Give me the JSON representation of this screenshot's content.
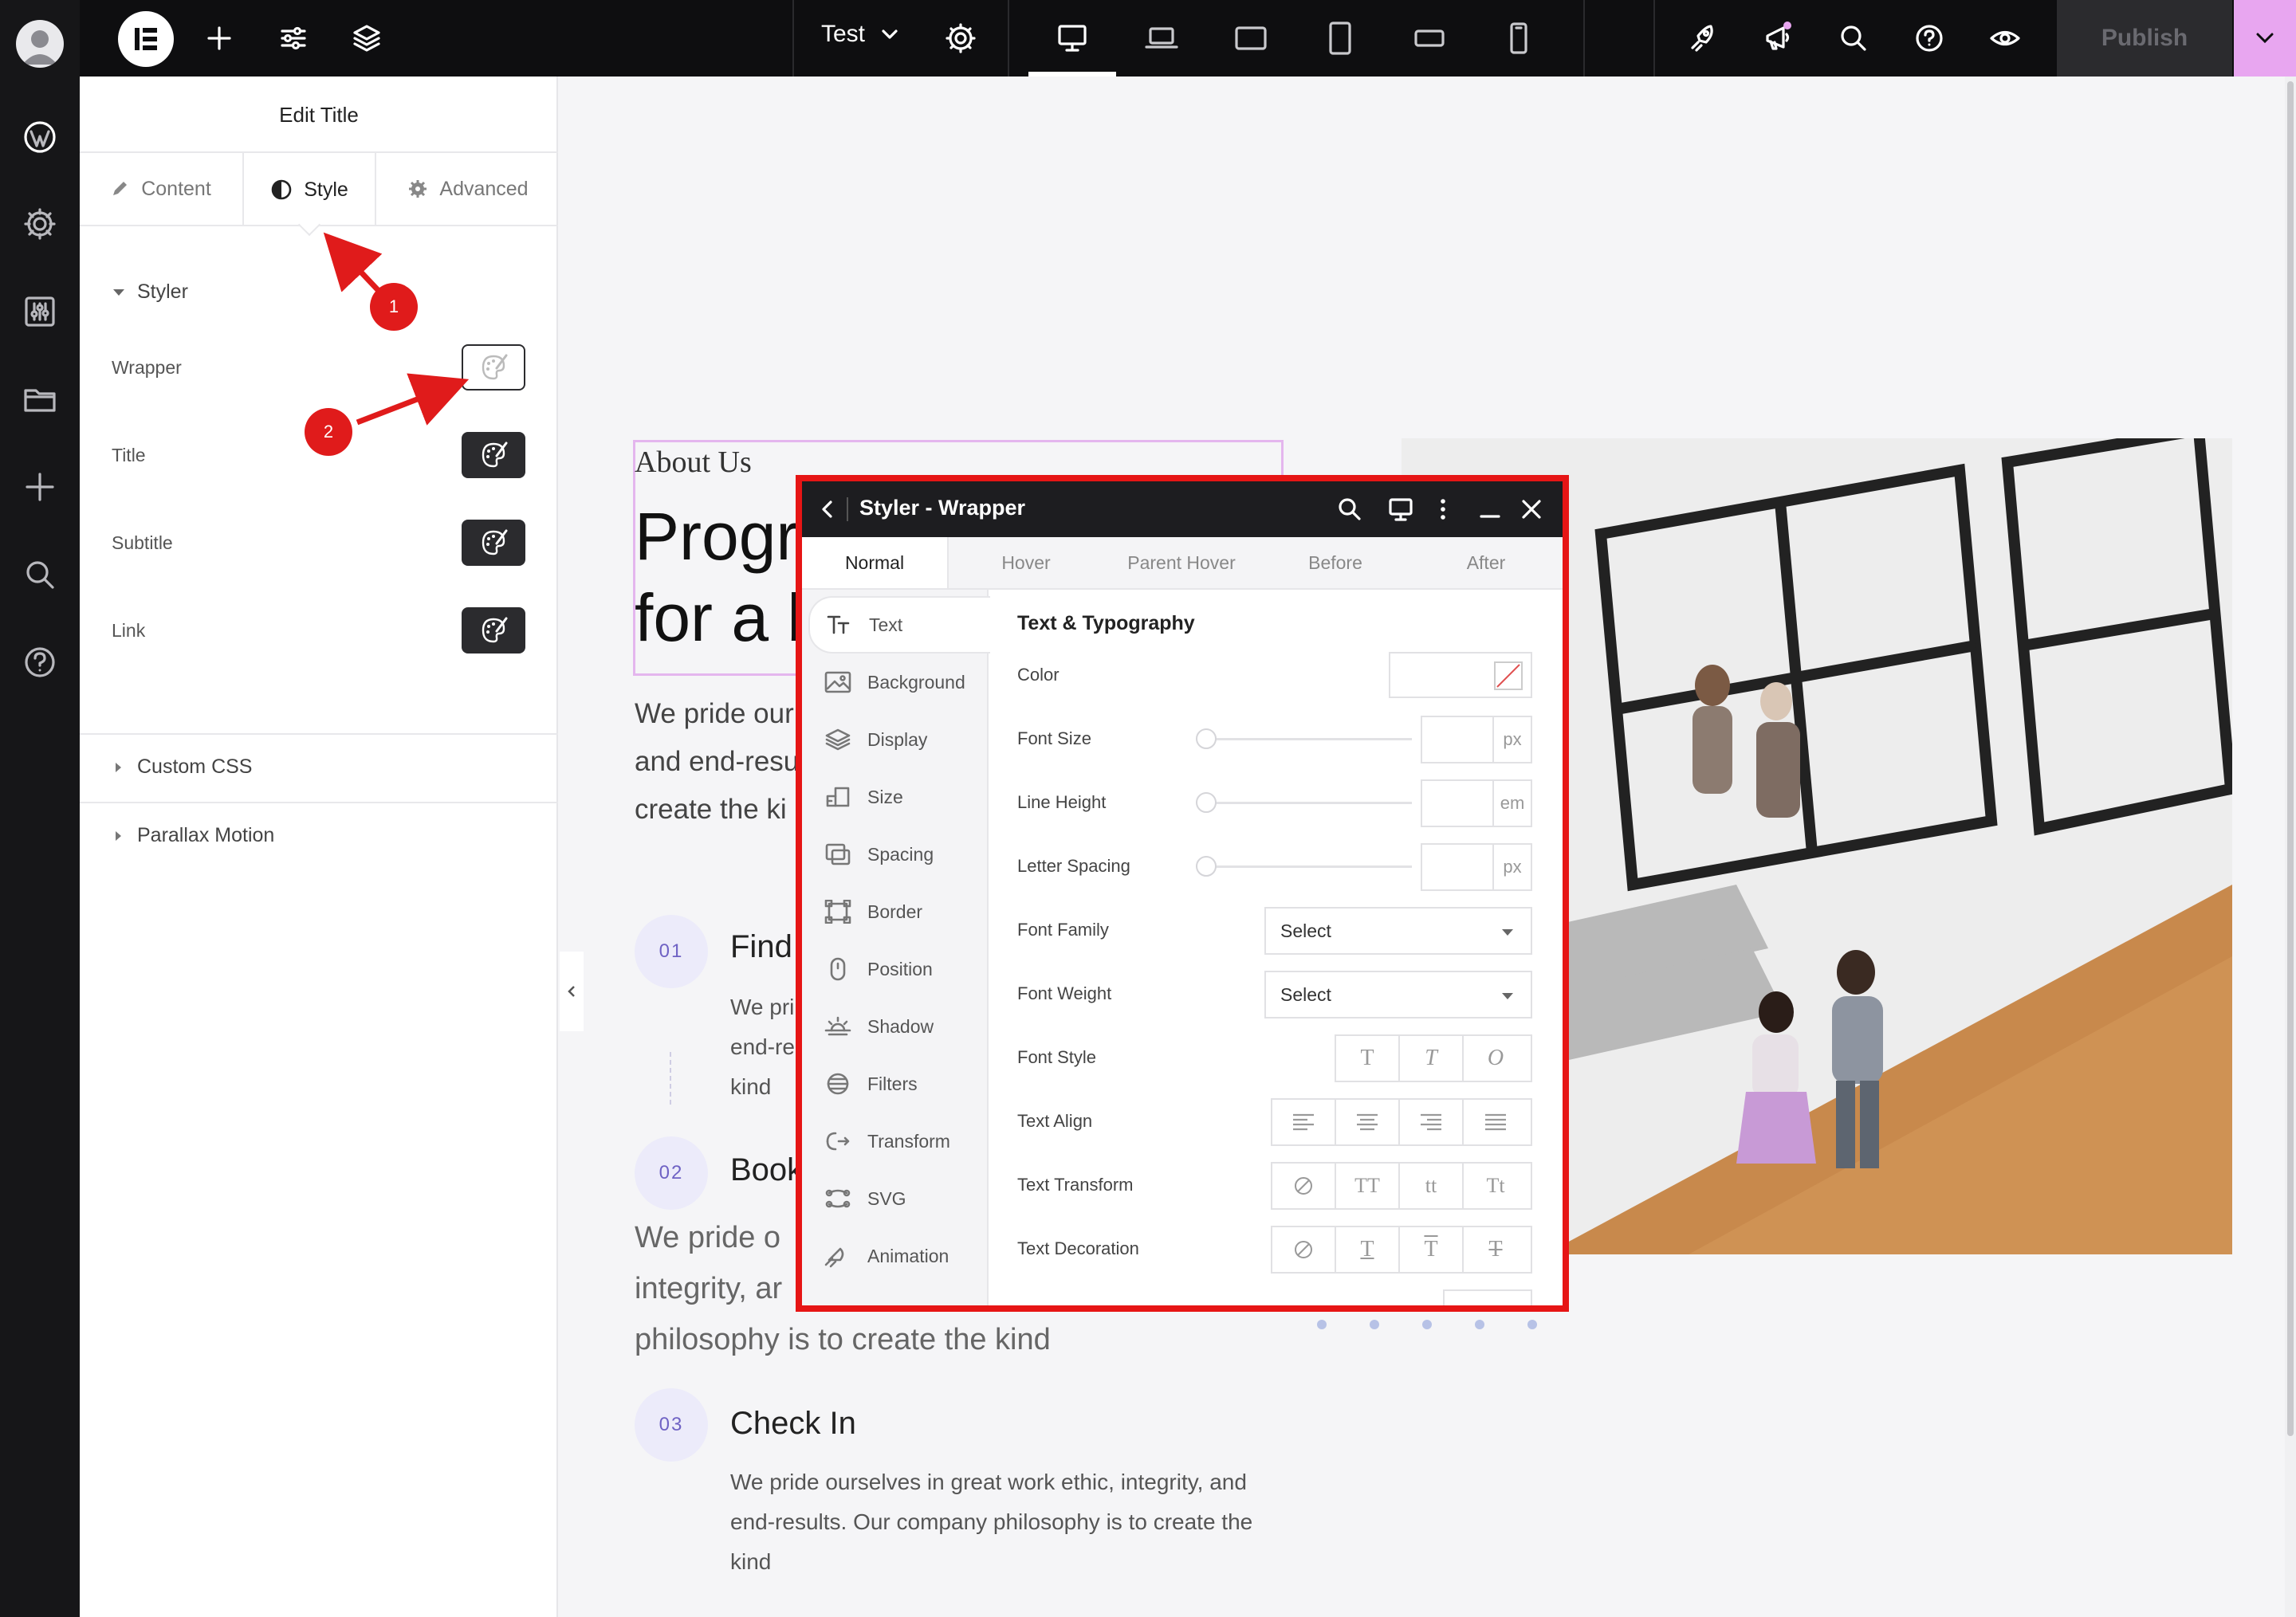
{
  "topbar": {
    "page_name": "Test",
    "publish_label": "Publish"
  },
  "panel": {
    "title": "Edit Title",
    "tabs": [
      {
        "label": "Content"
      },
      {
        "label": "Style"
      },
      {
        "label": "Advanced"
      }
    ],
    "section_styler": "Styler",
    "styler_rows": [
      {
        "label": "Wrapper"
      },
      {
        "label": "Title"
      },
      {
        "label": "Subtitle"
      },
      {
        "label": "Link"
      }
    ],
    "section_custom_css": "Custom CSS",
    "section_parallax": "Parallax Motion"
  },
  "canvas": {
    "eyebrow": "About Us",
    "heading_line1": "Progr",
    "heading_line2": "for a b",
    "intro_line1": "We pride our",
    "intro_line2": "and end-resu",
    "intro_line3": "create the ki",
    "steps": [
      {
        "number": "01",
        "title": "Find",
        "text_lines": [
          "We pri",
          "end-re",
          "kind"
        ]
      },
      {
        "number": "02",
        "title": "Book",
        "text_lines": [
          "We pride o",
          "integrity, ar",
          "philosophy is to create the kind"
        ]
      },
      {
        "number": "03",
        "title": "Check In",
        "text_lines": [
          "We pride ourselves in great work ethic, integrity, and",
          "end-results. Our company philosophy is to create the",
          "kind"
        ]
      }
    ]
  },
  "popup": {
    "title": "Styler - Wrapper",
    "state_tabs": [
      "Normal",
      "Hover",
      "Parent Hover",
      "Before",
      "After"
    ],
    "sidebar": [
      "Text",
      "Background",
      "Display",
      "Size",
      "Spacing",
      "Border",
      "Position",
      "Shadow",
      "Filters",
      "Transform",
      "SVG",
      "Animation"
    ],
    "section_title": "Text & Typography",
    "props": {
      "color": "Color",
      "font_size": "Font Size",
      "font_size_unit": "px",
      "line_height": "Line Height",
      "line_height_unit": "em",
      "letter_spacing": "Letter Spacing",
      "letter_spacing_unit": "px",
      "font_family": "Font Family",
      "font_family_value": "Select",
      "font_weight": "Font Weight",
      "font_weight_value": "Select",
      "font_style": "Font Style",
      "font_style_options": [
        "T",
        "T",
        "O"
      ],
      "text_align": "Text Align",
      "text_transform": "Text Transform",
      "text_transform_options": [
        "TT",
        "tt",
        "Tt"
      ],
      "text_decoration": "Text Decoration",
      "text_decoration_options": [
        "T",
        "T",
        "T"
      ]
    }
  },
  "annotations": [
    "1",
    "2"
  ],
  "colors": {
    "accent_pink": "#e8a6f0",
    "highlight_red": "#e61515",
    "step_purple": "#6f62c4"
  }
}
